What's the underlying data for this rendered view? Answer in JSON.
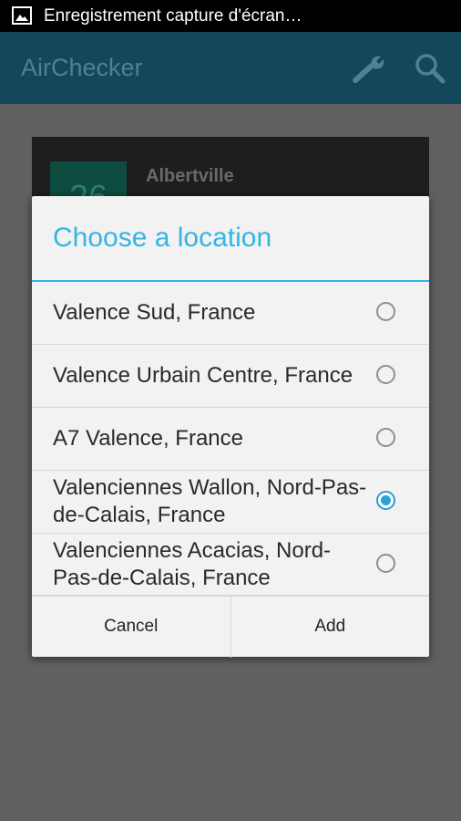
{
  "status_bar": {
    "notification_icon": "image-icon",
    "text": "Enregistrement capture d'écran…"
  },
  "app_bar": {
    "title": "AirChecker",
    "actions": [
      "wrench-icon",
      "search-icon"
    ]
  },
  "background_card": {
    "value": "26",
    "city": "Albertville"
  },
  "dialog": {
    "title": "Choose a location",
    "options": [
      {
        "label": "Valence Sud, France",
        "selected": false
      },
      {
        "label": "Valence Urbain Centre, France",
        "selected": false
      },
      {
        "label": "A7 Valence, France",
        "selected": false
      },
      {
        "label": "Valenciennes Wallon, Nord-Pas-de-Calais, France",
        "selected": true
      },
      {
        "label": "Valenciennes Acacias, Nord-Pas-de-Calais, France",
        "selected": false
      }
    ],
    "buttons": {
      "cancel": "Cancel",
      "add": "Add"
    }
  },
  "colors": {
    "accent": "#33b5e5",
    "app_bar": "#13485c",
    "dim_background": "#616161",
    "radio_selected": "#29a3d8"
  }
}
